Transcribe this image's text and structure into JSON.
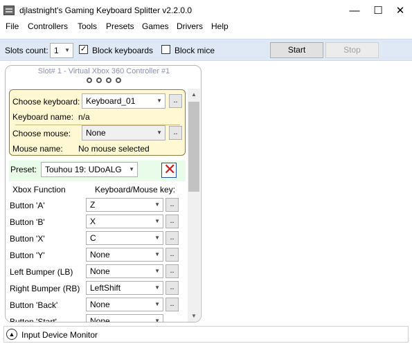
{
  "window": {
    "title": "djlastnight's Gaming Keyboard Splitter v2.2.0.0",
    "minimize_glyph": "—",
    "maximize_glyph": "☐",
    "close_glyph": "✕"
  },
  "menu": [
    "File",
    "Controllers",
    "Tools",
    "Presets",
    "Games",
    "Drivers",
    "Help"
  ],
  "toolbar": {
    "slots_label": "Slots count:",
    "slots_value": "1",
    "block_keyboards_label": "Block keyboards",
    "block_keyboards_checked": true,
    "block_mice_label": "Block mice",
    "block_mice_checked": false,
    "start_label": "Start",
    "stop_label": "Stop"
  },
  "slot": {
    "title": "Slot# 1 - Virtual Xbox 360 Controller #1",
    "choose_keyboard_label": "Choose keyboard:",
    "keyboard_value": "Keyboard_01",
    "keyboard_name_label": "Keyboard name:",
    "keyboard_name_value": "n/a",
    "choose_mouse_label": "Choose mouse:",
    "mouse_value": "None",
    "mouse_name_label": "Mouse name:",
    "mouse_name_value": "No mouse selected",
    "browse_label": "..",
    "preset_label": "Preset:",
    "preset_value": "Touhou 19: UDoALG",
    "col_function": "Xbox Function",
    "col_key": "Keyboard/Mouse key:",
    "mappings": [
      {
        "function": "Button 'A'",
        "key": "Z"
      },
      {
        "function": "Button 'B'",
        "key": "X"
      },
      {
        "function": "Button 'X'",
        "key": "C"
      },
      {
        "function": "Button 'Y'",
        "key": "None"
      },
      {
        "function": "Left Bumper (LB)",
        "key": "None"
      },
      {
        "function": "Right Bumper (RB)",
        "key": "LeftShift"
      },
      {
        "function": "Button 'Back'",
        "key": "None"
      },
      {
        "function": "Button 'Start'",
        "key": "None"
      }
    ]
  },
  "monitor": {
    "label": "Input Device Monitor"
  },
  "icons": {
    "app": "keyboard-icon",
    "dropdown": "chevron-down-icon",
    "delete": "delete-x-icon",
    "expand": "chevron-up-circle-icon"
  },
  "colors": {
    "toolbar_bg": "#dfe9f5",
    "device_box_bg": "#fff8d2",
    "preset_bg": "#e9fbe9",
    "delete_x": "#d01818",
    "slot_title": "#8a8fb5"
  }
}
